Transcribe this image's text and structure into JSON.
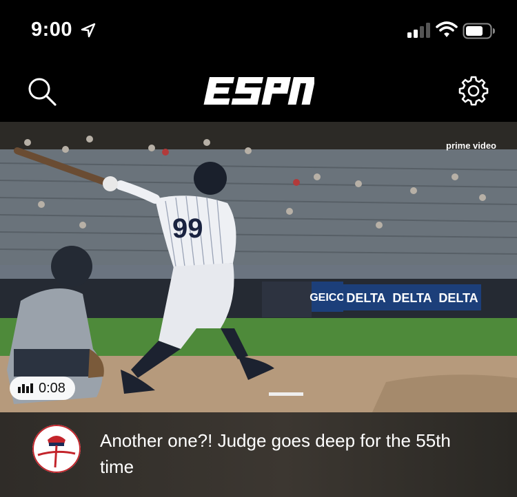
{
  "status_bar": {
    "time": "9:00"
  },
  "header": {
    "logo_text": "ESPN",
    "icons": [
      "search-icon",
      "gear-icon"
    ]
  },
  "video": {
    "badge": "prime video",
    "duration": "0:08",
    "jersey_number": "99",
    "ads": [
      "GEICO",
      "DELTA",
      "DELTA",
      "DELTA"
    ]
  },
  "story": {
    "headline": "Another one?! Judge goes deep for the 55th time",
    "team_logo_text": "Yankees"
  },
  "colors": {
    "background": "#000000",
    "caption_bg": "#37332e",
    "ad_blue": "#1c3f7a"
  }
}
